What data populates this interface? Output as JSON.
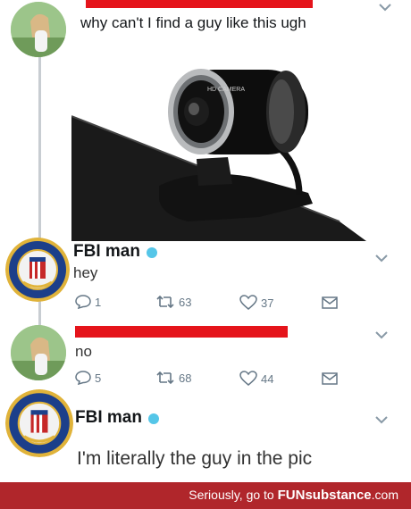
{
  "tweet1": {
    "text": "why can't I find a guy like this ugh",
    "image_alt": "webcam photo"
  },
  "reply1": {
    "name": "FBI man",
    "text": "hey",
    "replies": "1",
    "retweets": "63",
    "likes": "37"
  },
  "reply2": {
    "text": "no",
    "replies": "5",
    "retweets": "68",
    "likes": "44"
  },
  "reply3": {
    "name": "FBI man",
    "text": "I'm literally the guy in the pic"
  },
  "webcam": {
    "brand": "HD CAMERA"
  },
  "footer": {
    "prefix": "Seriously, go to ",
    "brand": "FUNsubstance",
    "suffix": ".com"
  },
  "colors": {
    "redact": "#e5141b",
    "verified": "#55c6e8",
    "footer": "#b0262b",
    "icon_gray": "#657786"
  }
}
